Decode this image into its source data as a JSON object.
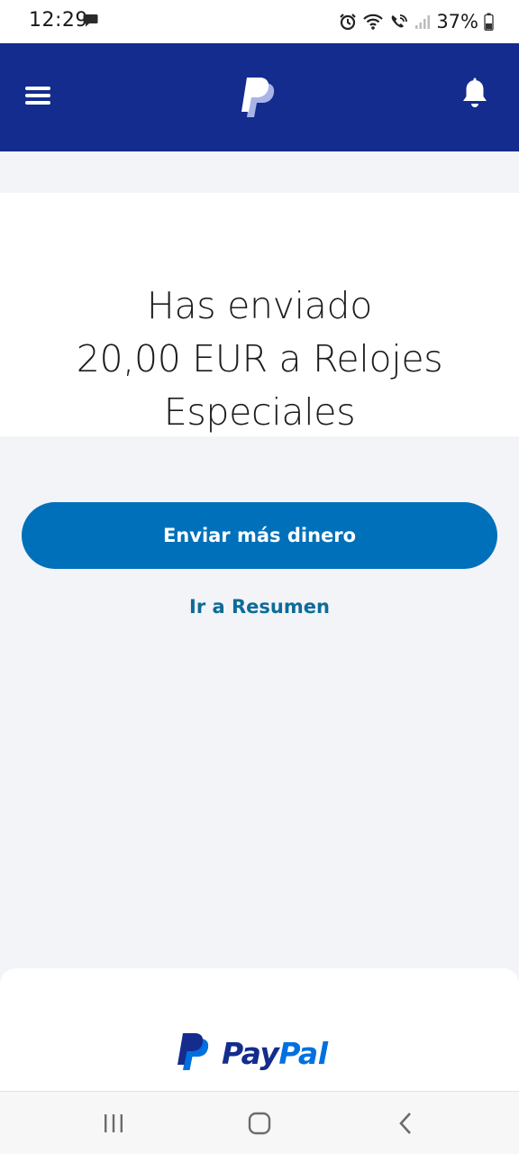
{
  "status_bar": {
    "time": "12:29",
    "battery": "37%"
  },
  "header": {
    "menu_icon": "hamburger-menu-icon",
    "logo_icon": "paypal-logo-icon",
    "bell_icon": "notification-bell-icon"
  },
  "confirmation": {
    "line1": "Has enviado",
    "line2": "20,00 EUR a Relojes",
    "line3": "Especiales"
  },
  "actions": {
    "send_more_label": "Enviar más dinero",
    "summary_link_label": "Ir a Resumen"
  },
  "footer": {
    "wordmark_pay": "Pay",
    "wordmark_pal": "Pal"
  },
  "nav": {
    "recents_icon": "recent-apps-icon",
    "home_icon": "home-icon",
    "back_icon": "back-icon"
  },
  "colors": {
    "brand_navy": "#142c8e",
    "brand_blue": "#0070ba",
    "link_blue": "#0e6b99",
    "background": "#f2f4f7"
  }
}
